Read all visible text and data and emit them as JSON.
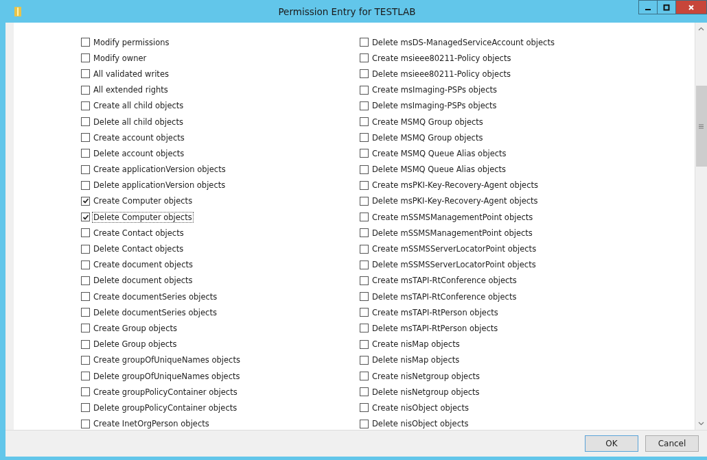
{
  "window": {
    "title": "Permission Entry for TESTLAB"
  },
  "columns": [
    [
      {
        "label": "Modify permissions",
        "checked": false,
        "focused": false
      },
      {
        "label": "Modify owner",
        "checked": false,
        "focused": false
      },
      {
        "label": "All validated writes",
        "checked": false,
        "focused": false
      },
      {
        "label": "All extended rights",
        "checked": false,
        "focused": false
      },
      {
        "label": "Create all child objects",
        "checked": false,
        "focused": false
      },
      {
        "label": "Delete all child objects",
        "checked": false,
        "focused": false
      },
      {
        "label": "Create account objects",
        "checked": false,
        "focused": false
      },
      {
        "label": "Delete account objects",
        "checked": false,
        "focused": false
      },
      {
        "label": "Create applicationVersion objects",
        "checked": false,
        "focused": false
      },
      {
        "label": "Delete applicationVersion objects",
        "checked": false,
        "focused": false
      },
      {
        "label": "Create Computer objects",
        "checked": true,
        "focused": false
      },
      {
        "label": "Delete Computer objects",
        "checked": true,
        "focused": true
      },
      {
        "label": "Create Contact objects",
        "checked": false,
        "focused": false
      },
      {
        "label": "Delete Contact objects",
        "checked": false,
        "focused": false
      },
      {
        "label": "Create document objects",
        "checked": false,
        "focused": false
      },
      {
        "label": "Delete document objects",
        "checked": false,
        "focused": false
      },
      {
        "label": "Create documentSeries objects",
        "checked": false,
        "focused": false
      },
      {
        "label": "Delete documentSeries objects",
        "checked": false,
        "focused": false
      },
      {
        "label": "Create Group objects",
        "checked": false,
        "focused": false
      },
      {
        "label": "Delete Group objects",
        "checked": false,
        "focused": false
      },
      {
        "label": "Create groupOfUniqueNames objects",
        "checked": false,
        "focused": false
      },
      {
        "label": "Delete groupOfUniqueNames objects",
        "checked": false,
        "focused": false
      },
      {
        "label": "Create groupPolicyContainer objects",
        "checked": false,
        "focused": false
      },
      {
        "label": "Delete groupPolicyContainer objects",
        "checked": false,
        "focused": false
      },
      {
        "label": "Create InetOrgPerson objects",
        "checked": false,
        "focused": false
      }
    ],
    [
      {
        "label": "Delete msDS-ManagedServiceAccount objects",
        "checked": false,
        "focused": false
      },
      {
        "label": "Create msieee80211-Policy objects",
        "checked": false,
        "focused": false
      },
      {
        "label": "Delete msieee80211-Policy objects",
        "checked": false,
        "focused": false
      },
      {
        "label": "Create msImaging-PSPs objects",
        "checked": false,
        "focused": false
      },
      {
        "label": "Delete msImaging-PSPs objects",
        "checked": false,
        "focused": false
      },
      {
        "label": "Create MSMQ Group objects",
        "checked": false,
        "focused": false
      },
      {
        "label": "Delete MSMQ Group objects",
        "checked": false,
        "focused": false
      },
      {
        "label": "Create MSMQ Queue Alias objects",
        "checked": false,
        "focused": false
      },
      {
        "label": "Delete MSMQ Queue Alias objects",
        "checked": false,
        "focused": false
      },
      {
        "label": "Create msPKI-Key-Recovery-Agent objects",
        "checked": false,
        "focused": false
      },
      {
        "label": "Delete msPKI-Key-Recovery-Agent objects",
        "checked": false,
        "focused": false
      },
      {
        "label": "Create mSSMSManagementPoint objects",
        "checked": false,
        "focused": false
      },
      {
        "label": "Delete mSSMSManagementPoint objects",
        "checked": false,
        "focused": false
      },
      {
        "label": "Create mSSMSServerLocatorPoint objects",
        "checked": false,
        "focused": false
      },
      {
        "label": "Delete mSSMSServerLocatorPoint objects",
        "checked": false,
        "focused": false
      },
      {
        "label": "Create msTAPI-RtConference objects",
        "checked": false,
        "focused": false
      },
      {
        "label": "Delete msTAPI-RtConference objects",
        "checked": false,
        "focused": false
      },
      {
        "label": "Create msTAPI-RtPerson objects",
        "checked": false,
        "focused": false
      },
      {
        "label": "Delete msTAPI-RtPerson objects",
        "checked": false,
        "focused": false
      },
      {
        "label": "Create nisMap objects",
        "checked": false,
        "focused": false
      },
      {
        "label": "Delete nisMap objects",
        "checked": false,
        "focused": false
      },
      {
        "label": "Create nisNetgroup objects",
        "checked": false,
        "focused": false
      },
      {
        "label": "Delete nisNetgroup objects",
        "checked": false,
        "focused": false
      },
      {
        "label": "Create nisObject objects",
        "checked": false,
        "focused": false
      },
      {
        "label": "Delete nisObject objects",
        "checked": false,
        "focused": false
      }
    ]
  ],
  "buttons": [
    {
      "label": "OK"
    },
    {
      "label": "Cancel"
    }
  ]
}
